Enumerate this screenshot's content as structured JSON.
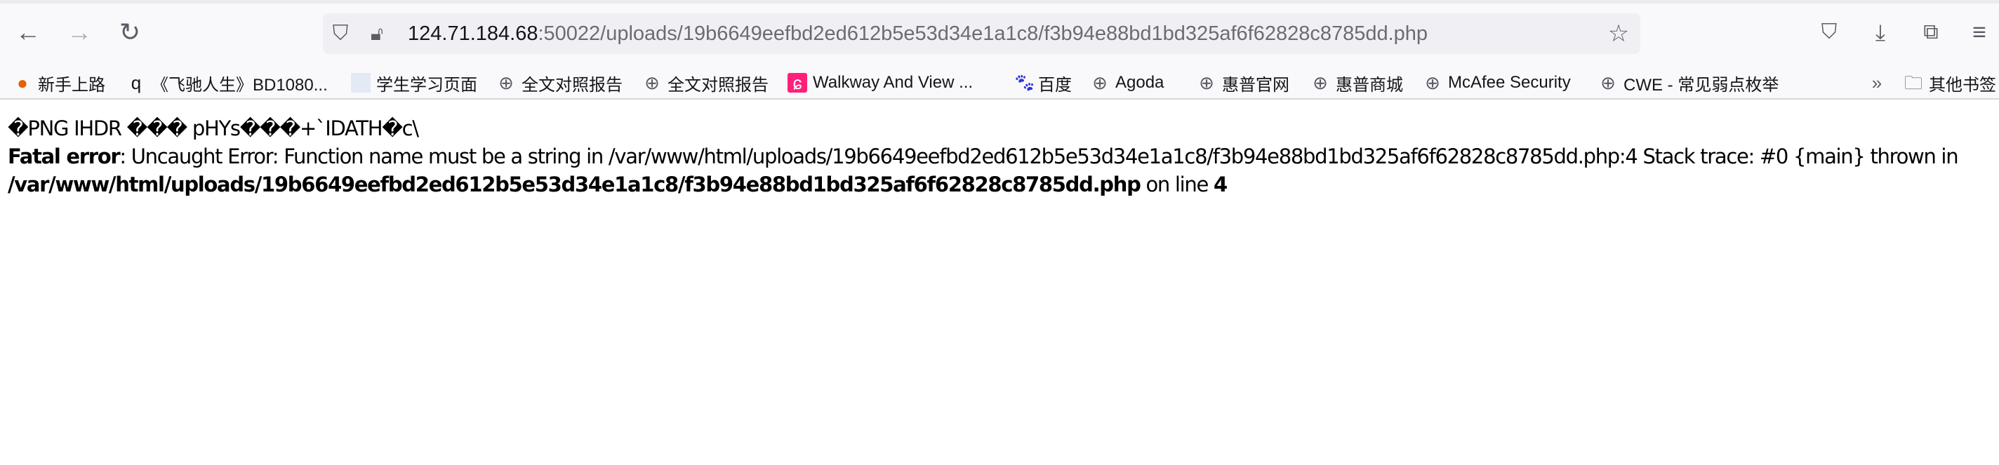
{
  "browser": {
    "url_host": "124.71.184.68",
    "url_rest": ":50022/uploads/19b6649eefbd2ed612b5e53d34e1a1c8/f3b94e88bd1bd325af6f62828c8785dd.php"
  },
  "bookmarks": [
    {
      "label": "新手上路",
      "icon": "firefox-icon"
    },
    {
      "label": "《飞驰人生》BD1080...",
      "icon": "q-icon"
    },
    {
      "label": "学生学习页面",
      "icon": "blank-page-icon"
    },
    {
      "label": "全文对照报告",
      "icon": "globe-icon"
    },
    {
      "label": "全文对照报告",
      "icon": "globe-icon"
    },
    {
      "label": "Walkway And View ...",
      "icon": "walkway-icon"
    },
    {
      "label": "百度",
      "icon": "baidu-paw-icon"
    },
    {
      "label": "Agoda",
      "icon": "globe-icon"
    },
    {
      "label": "惠普官网",
      "icon": "globe-icon"
    },
    {
      "label": "惠普商城",
      "icon": "globe-icon"
    },
    {
      "label": "McAfee Security",
      "icon": "globe-icon"
    },
    {
      "label": "CWE - 常见弱点枚举",
      "icon": "globe-icon"
    }
  ],
  "other_bookmarks": "其他书签",
  "page": {
    "garbage_line": "�PNG  IHDR ��� pHYs���+`IDATH�c\\",
    "fatal_label": "Fatal error",
    "error_message": ": Uncaught Error: Function name must be a string in /var/www/html/uploads/19b6649eefbd2ed612b5e53d34e1a1c8/f3b94e88bd1bd325af6f62828c8785dd.php:4 Stack trace: #0 {main} thrown in ",
    "error_file": "/var/www/html/uploads/19b6649eefbd2ed612b5e53d34e1a1c8/f3b94e88bd1bd325af6f62828c8785dd.php",
    "on_line_text": " on line ",
    "line_number": "4"
  }
}
